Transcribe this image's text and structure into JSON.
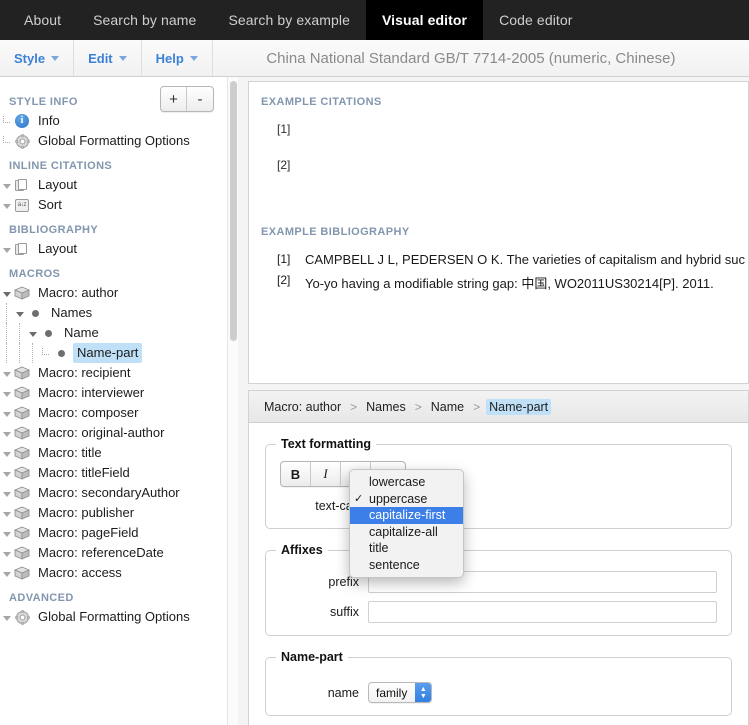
{
  "topnav": {
    "tabs": [
      {
        "label": "About",
        "active": false
      },
      {
        "label": "Search by name",
        "active": false
      },
      {
        "label": "Search by example",
        "active": false
      },
      {
        "label": "Visual editor",
        "active": true
      },
      {
        "label": "Code editor",
        "active": false
      }
    ]
  },
  "menustrip": {
    "menus": [
      {
        "label": "Style"
      },
      {
        "label": "Edit"
      },
      {
        "label": "Help"
      }
    ],
    "style_title": "China National Standard GB/T 7714-2005 (numeric, Chinese)"
  },
  "sidebar": {
    "expand_button": "+",
    "collapse_button": "-",
    "groups": [
      {
        "label": "STYLE INFO",
        "items": [
          {
            "label": "Info",
            "icon": "info-icon",
            "indent": 1,
            "twisty": "leaf"
          },
          {
            "label": "Global Formatting Options",
            "icon": "gear-icon",
            "indent": 1,
            "twisty": "leaf"
          }
        ]
      },
      {
        "label": "INLINE CITATIONS",
        "items": [
          {
            "label": "Layout",
            "icon": "pages-icon",
            "indent": 1,
            "twisty": "closed"
          },
          {
            "label": "Sort",
            "icon": "sort-icon",
            "indent": 1,
            "twisty": "closed"
          }
        ]
      },
      {
        "label": "BIBLIOGRAPHY",
        "items": [
          {
            "label": "Layout",
            "icon": "pages-icon",
            "indent": 1,
            "twisty": "closed"
          }
        ]
      },
      {
        "label": "MACROS",
        "items": [
          {
            "label": "Macro: author",
            "icon": "macro-box-icon",
            "indent": 1,
            "twisty": "open"
          },
          {
            "label": "Names",
            "icon": "dot-icon",
            "indent": 2,
            "twisty": "open"
          },
          {
            "label": "Name",
            "icon": "dot-icon",
            "indent": 3,
            "twisty": "open"
          },
          {
            "label": "Name-part",
            "icon": "dot-icon",
            "indent": 4,
            "twisty": "leaf",
            "selected": true
          },
          {
            "label": "Macro: recipient",
            "icon": "macro-box-icon",
            "indent": 1,
            "twisty": "closed"
          },
          {
            "label": "Macro: interviewer",
            "icon": "macro-box-icon",
            "indent": 1,
            "twisty": "closed"
          },
          {
            "label": "Macro: composer",
            "icon": "macro-box-icon",
            "indent": 1,
            "twisty": "closed"
          },
          {
            "label": "Macro: original-author",
            "icon": "macro-box-icon",
            "indent": 1,
            "twisty": "closed"
          },
          {
            "label": "Macro: title",
            "icon": "macro-box-icon",
            "indent": 1,
            "twisty": "closed"
          },
          {
            "label": "Macro: titleField",
            "icon": "macro-box-icon",
            "indent": 1,
            "twisty": "closed"
          },
          {
            "label": "Macro: secondaryAuthor",
            "icon": "macro-box-icon",
            "indent": 1,
            "twisty": "closed"
          },
          {
            "label": "Macro: publisher",
            "icon": "macro-box-icon",
            "indent": 1,
            "twisty": "closed"
          },
          {
            "label": "Macro: pageField",
            "icon": "macro-box-icon",
            "indent": 1,
            "twisty": "closed"
          },
          {
            "label": "Macro: referenceDate",
            "icon": "macro-box-icon",
            "indent": 1,
            "twisty": "closed"
          },
          {
            "label": "Macro: access",
            "icon": "macro-box-icon",
            "indent": 1,
            "twisty": "closed"
          }
        ]
      },
      {
        "label": "ADVANCED",
        "items": [
          {
            "label": "Global Formatting Options",
            "icon": "gear-icon",
            "indent": 1,
            "twisty": "closed"
          }
        ]
      }
    ]
  },
  "preview": {
    "citations_heading": "EXAMPLE CITATIONS",
    "citations": [
      "[1]",
      "[2]"
    ],
    "bibliography_heading": "EXAMPLE BIBLIOGRAPHY",
    "bibliography": [
      {
        "num": "[1]",
        "text": "CAMPBELL J L, PEDERSEN O K. The varieties of capitalism and hybrid suc"
      },
      {
        "num": "[2]",
        "text": "Yo-yo having a modifiable string gap: 中国, WO2011US30214[P]. 2011."
      }
    ]
  },
  "editor": {
    "breadcrumb": [
      {
        "label": "Macro: author",
        "active": false
      },
      {
        "label": "Names",
        "active": false
      },
      {
        "label": "Name",
        "active": false
      },
      {
        "label": "Name-part",
        "active": true
      }
    ],
    "breadcrumb_separator": ">",
    "text_formatting": {
      "legend": "Text formatting",
      "buttons": [
        {
          "label": "B",
          "name": "bold-button"
        },
        {
          "label": "I",
          "name": "italic-button"
        },
        {
          "label": "U",
          "name": "underline-button"
        }
      ],
      "text_case_label": "text-cas"
    },
    "dropdown": {
      "options": [
        {
          "label": "lowercase",
          "checked": false,
          "highlighted": false
        },
        {
          "label": "uppercase",
          "checked": true,
          "highlighted": false
        },
        {
          "label": "capitalize-first",
          "checked": false,
          "highlighted": true
        },
        {
          "label": "capitalize-all",
          "checked": false,
          "highlighted": false
        },
        {
          "label": "title",
          "checked": false,
          "highlighted": false
        },
        {
          "label": "sentence",
          "checked": false,
          "highlighted": false
        }
      ],
      "check_glyph": "✓"
    },
    "affixes": {
      "legend": "Affixes",
      "prefix_label": "prefix",
      "prefix_value": "",
      "suffix_label": "suffix",
      "suffix_value": ""
    },
    "name_part": {
      "legend": "Name-part",
      "name_label": "name",
      "name_value": "family"
    }
  },
  "colors": {
    "nav_bg": "#222222",
    "nav_active_bg": "#000000",
    "accent_blue": "#3b82d6",
    "section_label": "#8296ae",
    "selection_blue": "#bfe0f7",
    "highlight_blue": "#3c7fe8"
  }
}
